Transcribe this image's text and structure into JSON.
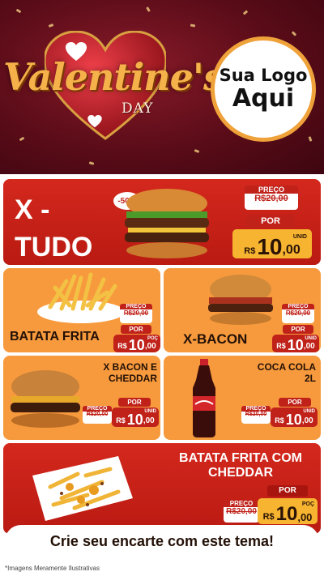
{
  "header": {
    "title": "Valentine's",
    "subtitle": "DAY",
    "logo_line1": "Sua Logo",
    "logo_line2": "Aqui"
  },
  "items": {
    "xtudo": {
      "name": "X - TUDO",
      "discount": "-50%",
      "old_label": "PREÇO",
      "old_price": "R$20,00",
      "por": "POR",
      "rs": "R$",
      "price_int": "10",
      "price_dec": ",00",
      "unit": "UNID"
    },
    "batata": {
      "name": "BATATA FRITA",
      "old_label": "PREÇO",
      "old_price": "R$20,00",
      "por": "POR",
      "rs": "R$",
      "price_int": "10",
      "price_dec": ",00",
      "unit": "POÇ"
    },
    "xbacon": {
      "name": "X-BACON",
      "old_label": "PREÇO",
      "old_price": "R$20,00",
      "por": "POR",
      "rs": "R$",
      "price_int": "10",
      "price_dec": ",00",
      "unit": "UNID"
    },
    "xbaconcheddar": {
      "name1": "X BACON E",
      "name2": "CHEDDAR",
      "old_label": "PREÇO",
      "old_price": "R$20,00",
      "por": "POR",
      "rs": "R$",
      "price_int": "10",
      "price_dec": ",00",
      "unit": "UNID"
    },
    "cocacola": {
      "name1": "COCA COLA",
      "name2": "2L",
      "old_label": "PREÇO",
      "old_price": "R$20,00",
      "por": "POR",
      "rs": "R$",
      "price_int": "10",
      "price_dec": ",00",
      "unit": "UNID"
    },
    "batatacheddar": {
      "name1": "BATATA FRITA COM",
      "name2": "CHEDDAR",
      "old_label": "PREÇO",
      "old_price": "R$20,00",
      "por": "POR",
      "rs": "R$",
      "price_int": "10",
      "price_dec": ",00",
      "unit": "POÇ"
    }
  },
  "footer": {
    "cta": "Crie seu encarte com este tema!",
    "disclaimer": "*Imagens Meramente Ilustrativas"
  },
  "colors": {
    "red": "#c0221a",
    "orange": "#f79a3d",
    "yellow": "#f6b431",
    "maroon": "#5a0c18"
  }
}
